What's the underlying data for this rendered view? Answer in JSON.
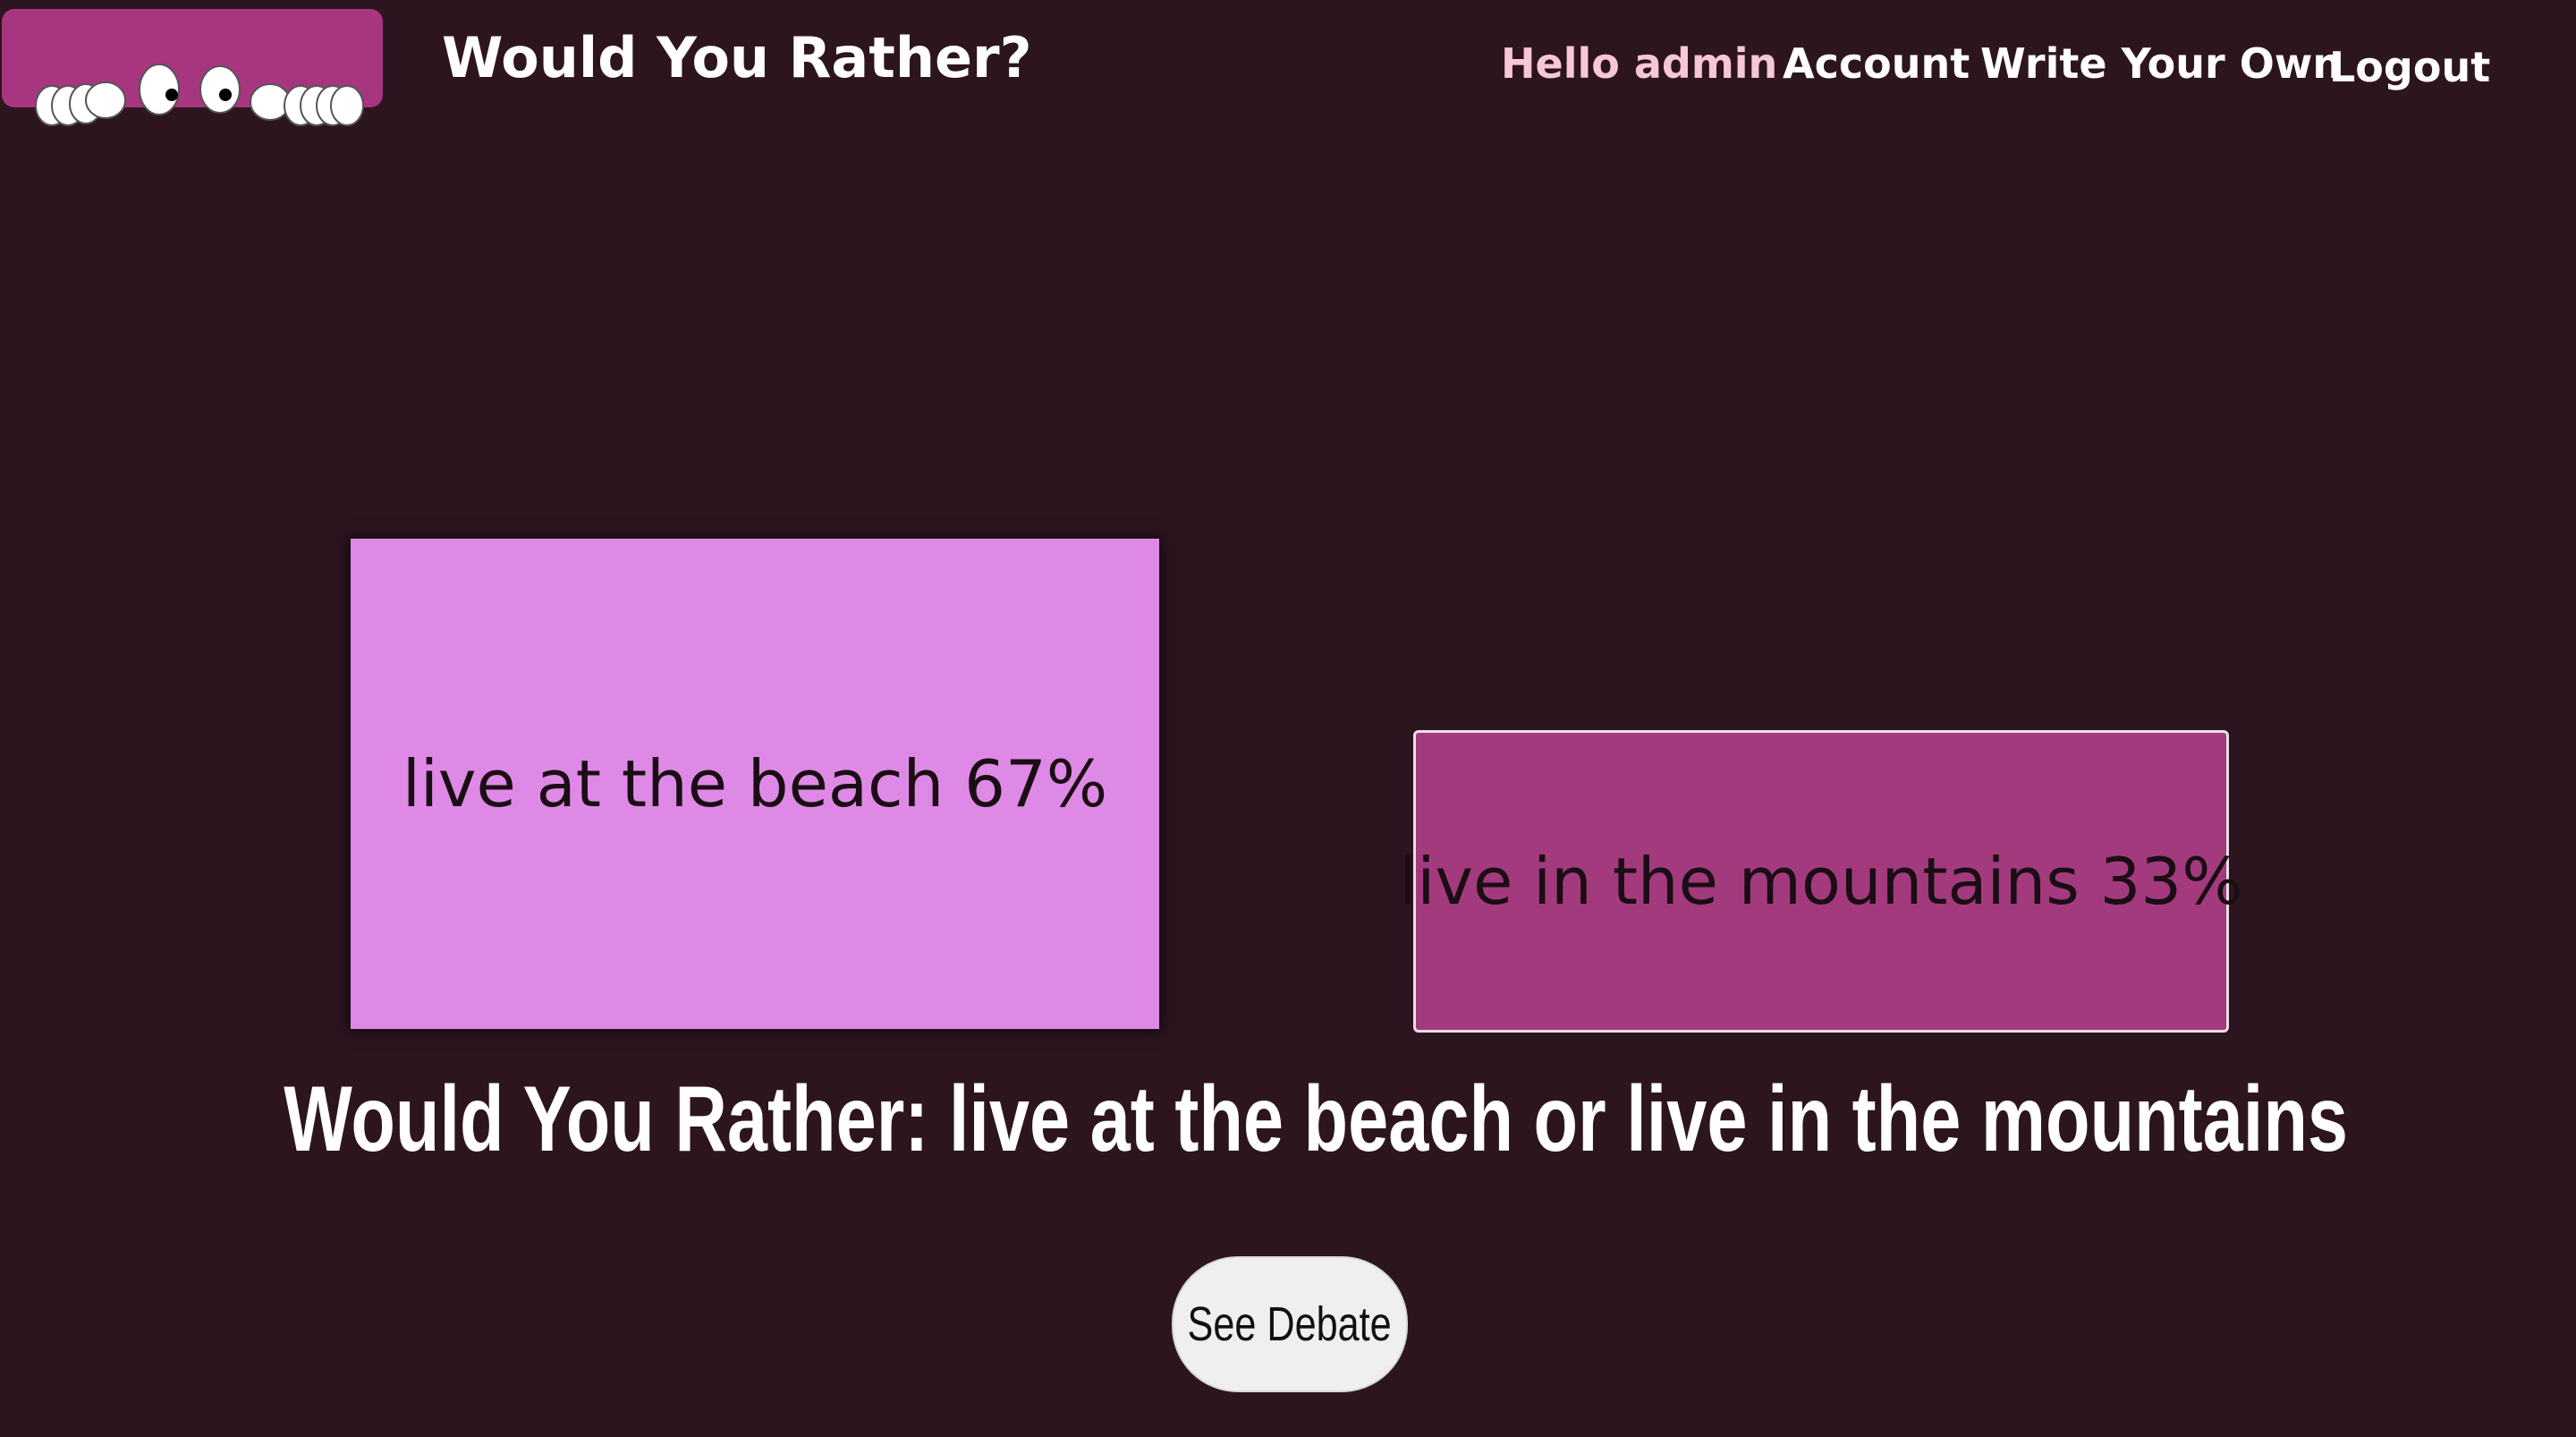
{
  "header": {
    "site_title": "Would You Rather?",
    "greeting": "Hello admin",
    "nav": {
      "account": "Account",
      "write_your_own": "Write Your Own",
      "logout": "Logout"
    }
  },
  "poll": {
    "option_a": "live at the beach 67%",
    "option_b": "live in the mountains 33%",
    "question": "Would You Rather: live at the beach or live in the mountains",
    "see_debate": "See Debate"
  },
  "colors": {
    "background": "#2d1520",
    "option_a": "#df89e6",
    "option_b": "#a33a7e",
    "logo": "#a7357f",
    "greeting": "#f7c6d9"
  },
  "icons": {
    "logo": "peeking-eyes-logo-icon"
  }
}
